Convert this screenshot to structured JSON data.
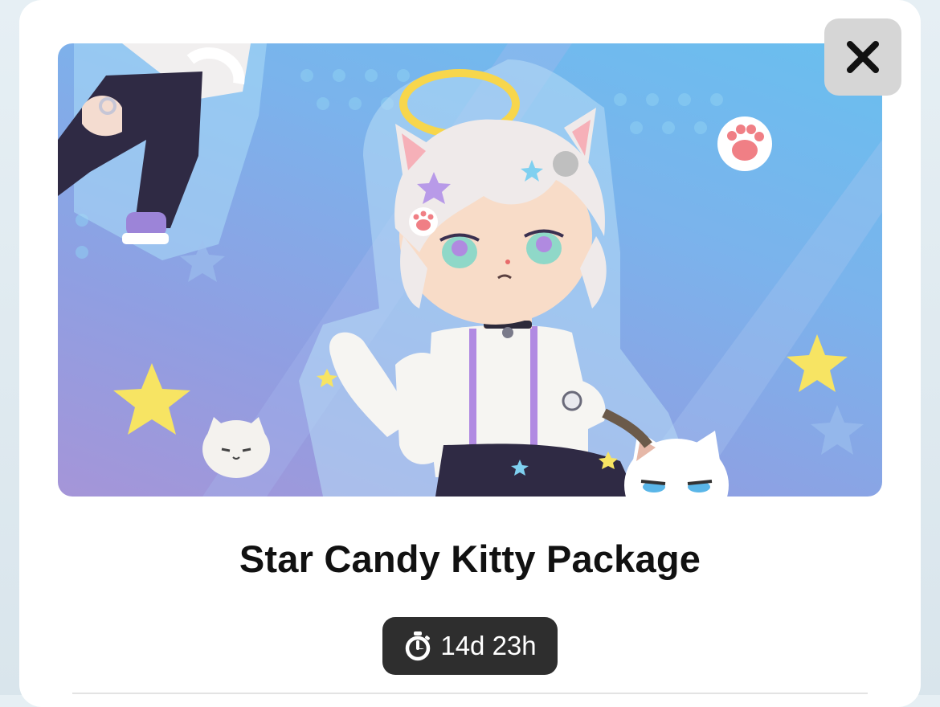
{
  "package": {
    "title": "Star Candy Kitty Package",
    "banner_alt": "character-artwork"
  },
  "timer": {
    "icon": "stopwatch-icon",
    "remaining": "14d 23h"
  },
  "close": {
    "icon": "close-icon",
    "label": ""
  },
  "colors": {
    "timer_bg": "#2e2e2e",
    "close_bg": "#d6d6d6",
    "title": "#111111",
    "banner_top": "#69bfef",
    "banner_bottom": "#a595d8"
  }
}
